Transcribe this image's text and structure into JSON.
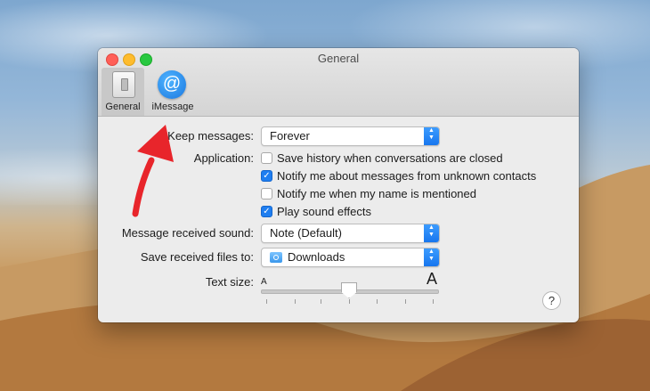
{
  "window": {
    "title": "General"
  },
  "toolbar": {
    "items": [
      {
        "label": "General",
        "icon": "switch-icon",
        "selected": true
      },
      {
        "label": "iMessage",
        "icon": "at-icon",
        "selected": false
      }
    ]
  },
  "settings": {
    "keep_messages": {
      "label": "Keep messages:",
      "value": "Forever"
    },
    "application": {
      "label": "Application:",
      "options": [
        {
          "label": "Save history when conversations are closed",
          "checked": false
        },
        {
          "label": "Notify me about messages from unknown contacts",
          "checked": true
        },
        {
          "label": "Notify me when my name is mentioned",
          "checked": false
        },
        {
          "label": "Play sound effects",
          "checked": true
        }
      ]
    },
    "received_sound": {
      "label": "Message received sound:",
      "value": "Note (Default)"
    },
    "save_files": {
      "label": "Save received files to:",
      "value": "Downloads",
      "icon": "folder-icon"
    },
    "text_size": {
      "label": "Text size:",
      "small_glyph": "A",
      "large_glyph": "A",
      "level_fraction": 0.5
    }
  },
  "help": {
    "label": "?"
  },
  "colors": {
    "accent": "#1f7ef0",
    "annotation_arrow": "#e8252b"
  }
}
